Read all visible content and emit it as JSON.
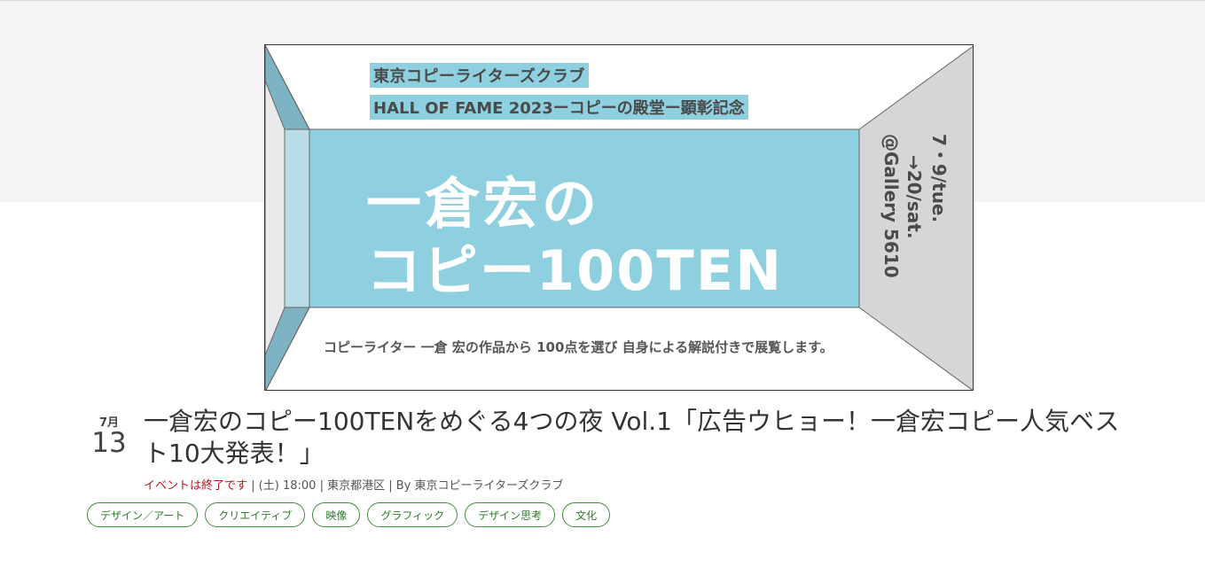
{
  "banner": {
    "org_line": "東京コピーライターズクラブ",
    "hof_line": "HALL OF FAME 2023ーコピーの殿堂ー顕彰記念",
    "big_line1": "一倉宏の",
    "big_line2": "コピー100TEN",
    "dates_line1": "7・9/tue.",
    "dates_line2": "→20/sat.",
    "venue": "@Gallery 5610",
    "description": "コピーライター 一倉 宏の作品から 100点を選び 自身による解説付きで展覧します。",
    "colors": {
      "accent": "#8ecfe0",
      "side": "#d6d6d6",
      "inner_side": "#7db3c2"
    }
  },
  "event": {
    "month": "7月",
    "day": "13",
    "title": "一倉宏のコピー100TENをめぐる4つの夜 Vol.1「広告ウヒョー！一倉宏コピー人気ベスト10大発表！」",
    "status": "イベントは終了です",
    "time": "(土) 18:00",
    "location": "東京都港区",
    "organizer": "By 東京コピーライターズクラブ"
  },
  "tags": [
    "デザイン／アート",
    "クリエイティブ",
    "映像",
    "グラフィック",
    "デザイン思考",
    "文化"
  ]
}
